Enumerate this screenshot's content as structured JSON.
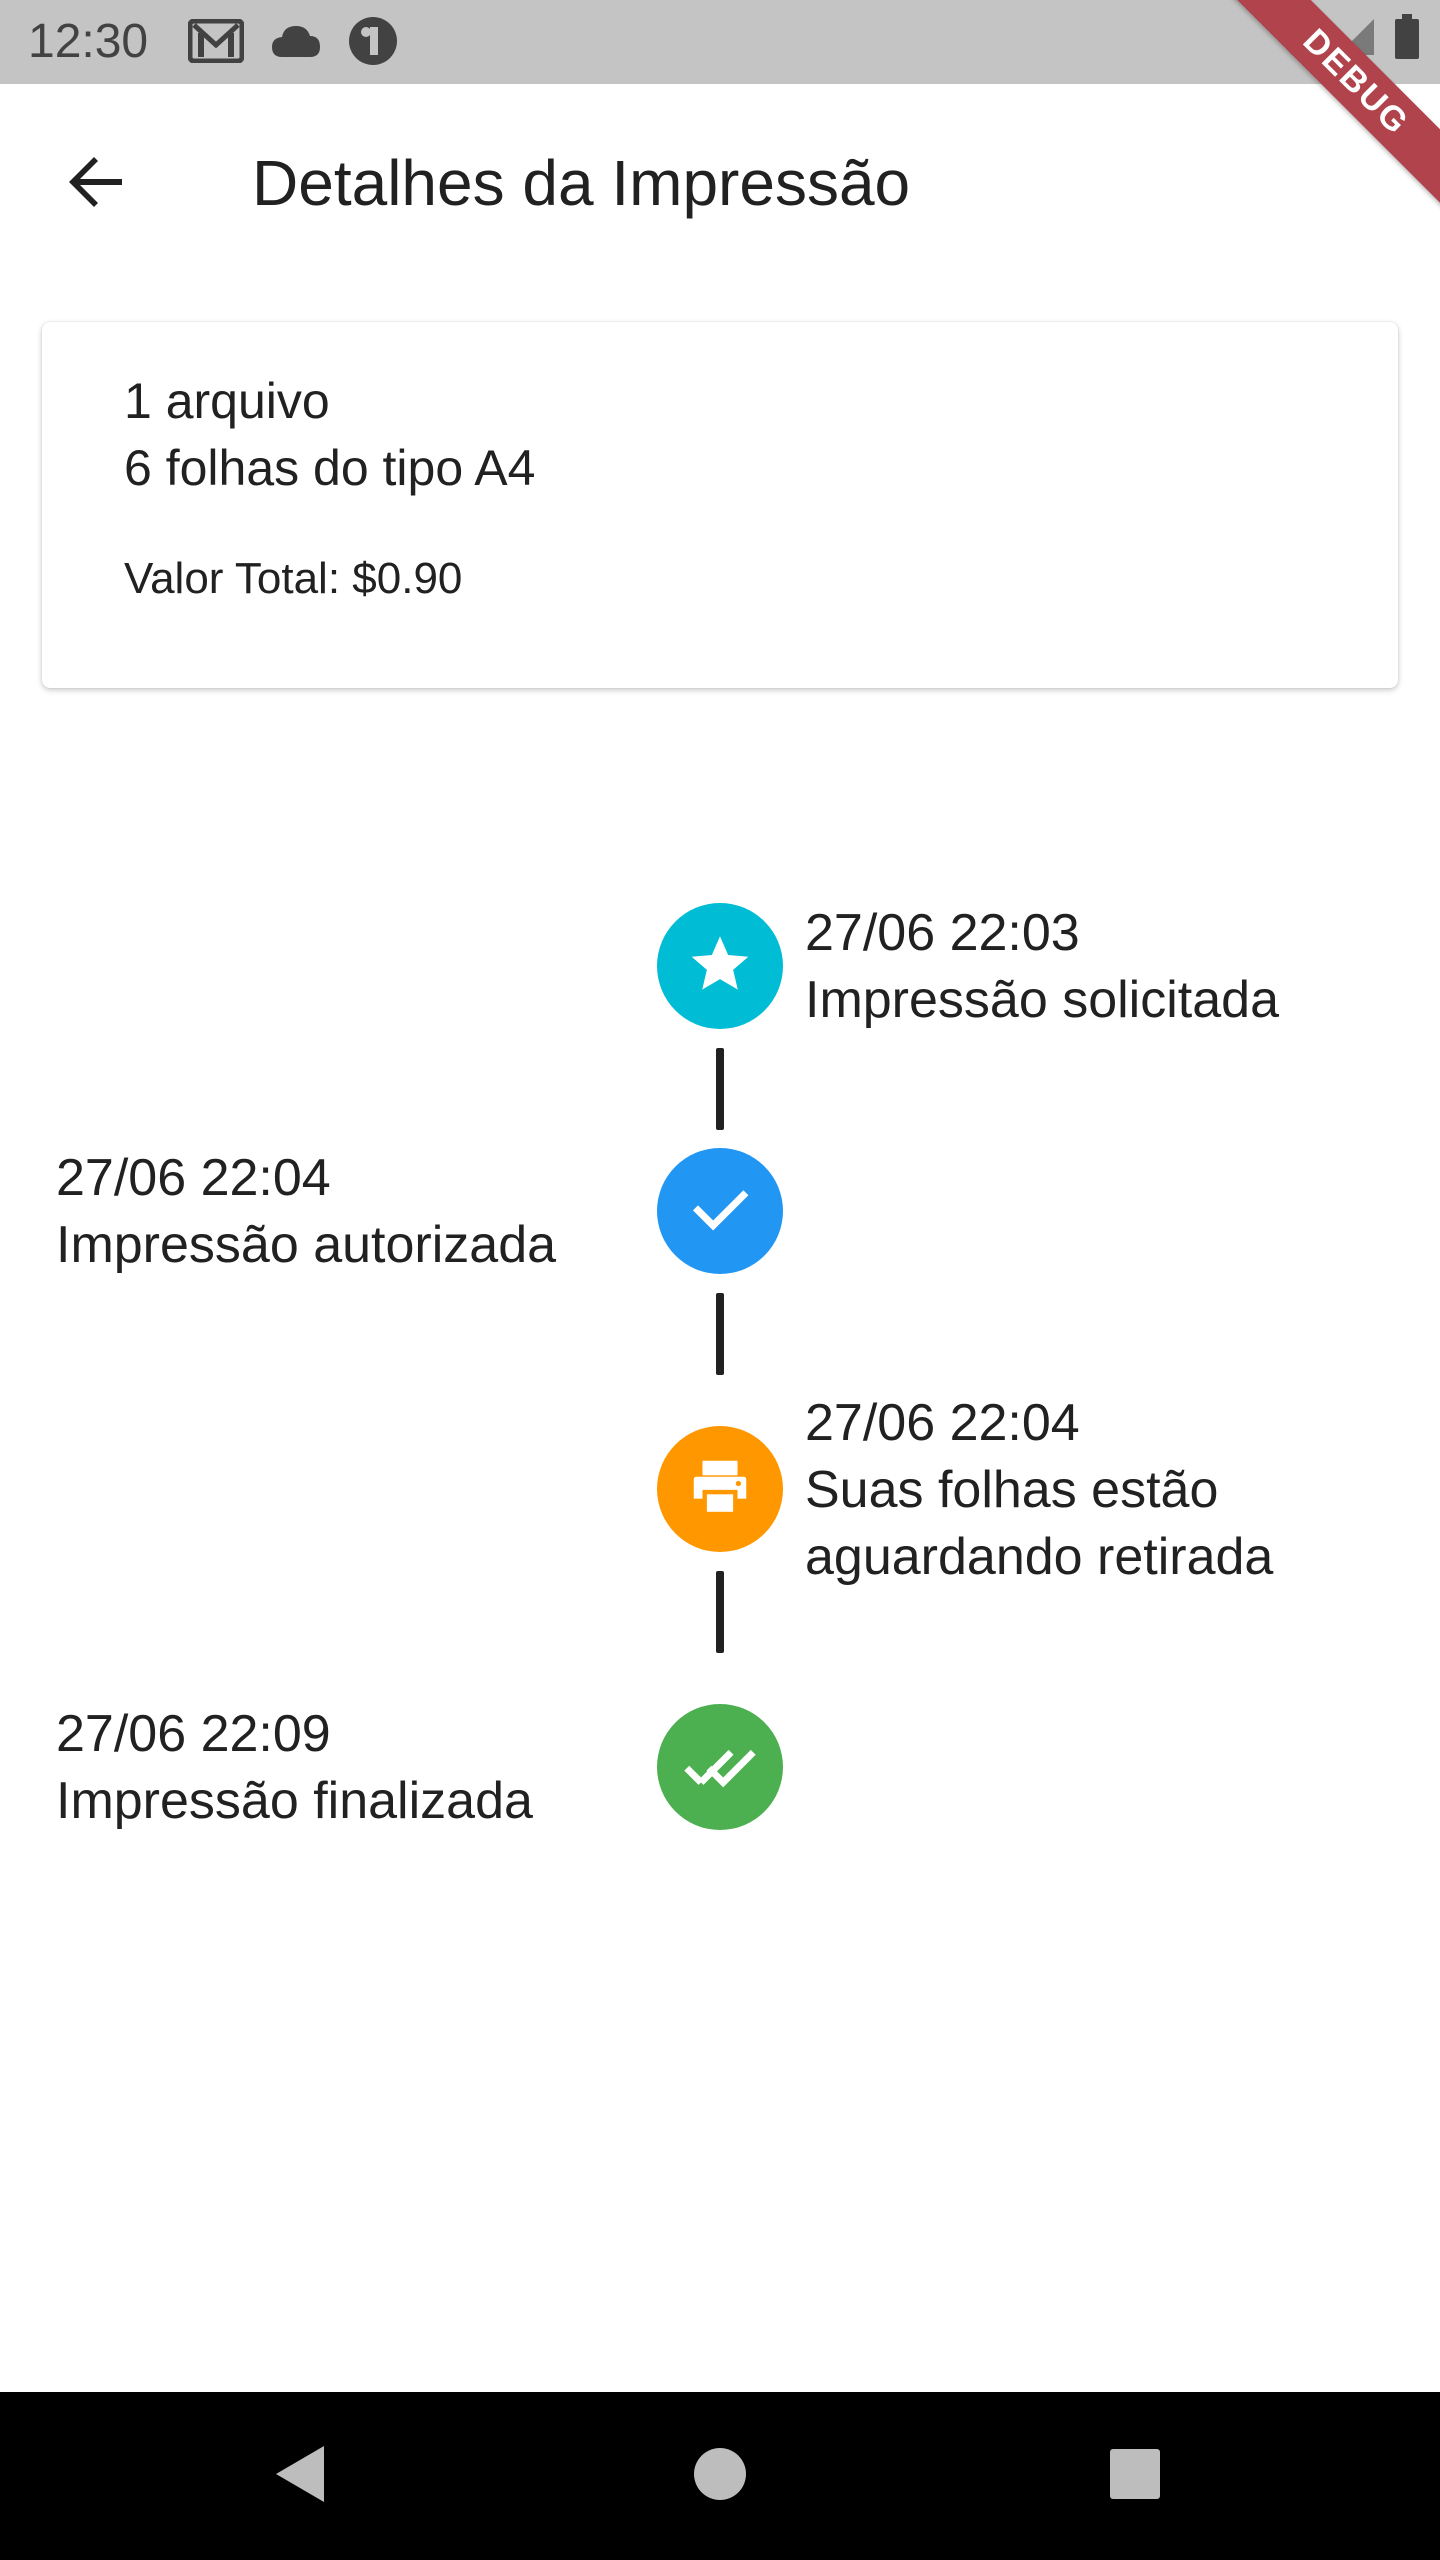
{
  "status_bar": {
    "time": "12:30",
    "left_icons": [
      "gmail-icon",
      "cloud-icon",
      "app-notification-icon"
    ],
    "right_icons": [
      "wifi-icon",
      "signal-icon",
      "battery-icon"
    ]
  },
  "debug_banner": "DEBUG",
  "app_bar": {
    "back_icon": "arrow-back-icon",
    "title": "Detalhes da Impressão"
  },
  "summary": {
    "files_line": "1 arquivo",
    "sheets_line": "6 folhas do tipo A4",
    "total_line": "Valor Total: $0.90"
  },
  "timeline": [
    {
      "side": "right",
      "datetime": "27/06 22:03",
      "label": "Impressão solicitada",
      "icon": "star-icon",
      "color": "#00bcd4"
    },
    {
      "side": "left",
      "datetime": "27/06 22:04",
      "label": "Impressão autorizada",
      "icon": "check-icon",
      "color": "#2196f3"
    },
    {
      "side": "right",
      "datetime": "27/06 22:04",
      "label_line1": "Suas folhas estão",
      "label_line2": "aguardando retirada",
      "icon": "printer-icon",
      "color": "#ff9800"
    },
    {
      "side": "left",
      "datetime": "27/06 22:09",
      "label": "Impressão finalizada",
      "icon": "double-check-icon",
      "color": "#4caf50"
    }
  ],
  "nav_bar": {
    "buttons": [
      "back-triangle-icon",
      "home-circle-icon",
      "recents-square-icon"
    ]
  },
  "colors": {
    "status_bar_bg": "#c4c4c4",
    "connector": "#212121",
    "nav_bar_bg": "#000000",
    "debug_ribbon": "#b0434b"
  }
}
